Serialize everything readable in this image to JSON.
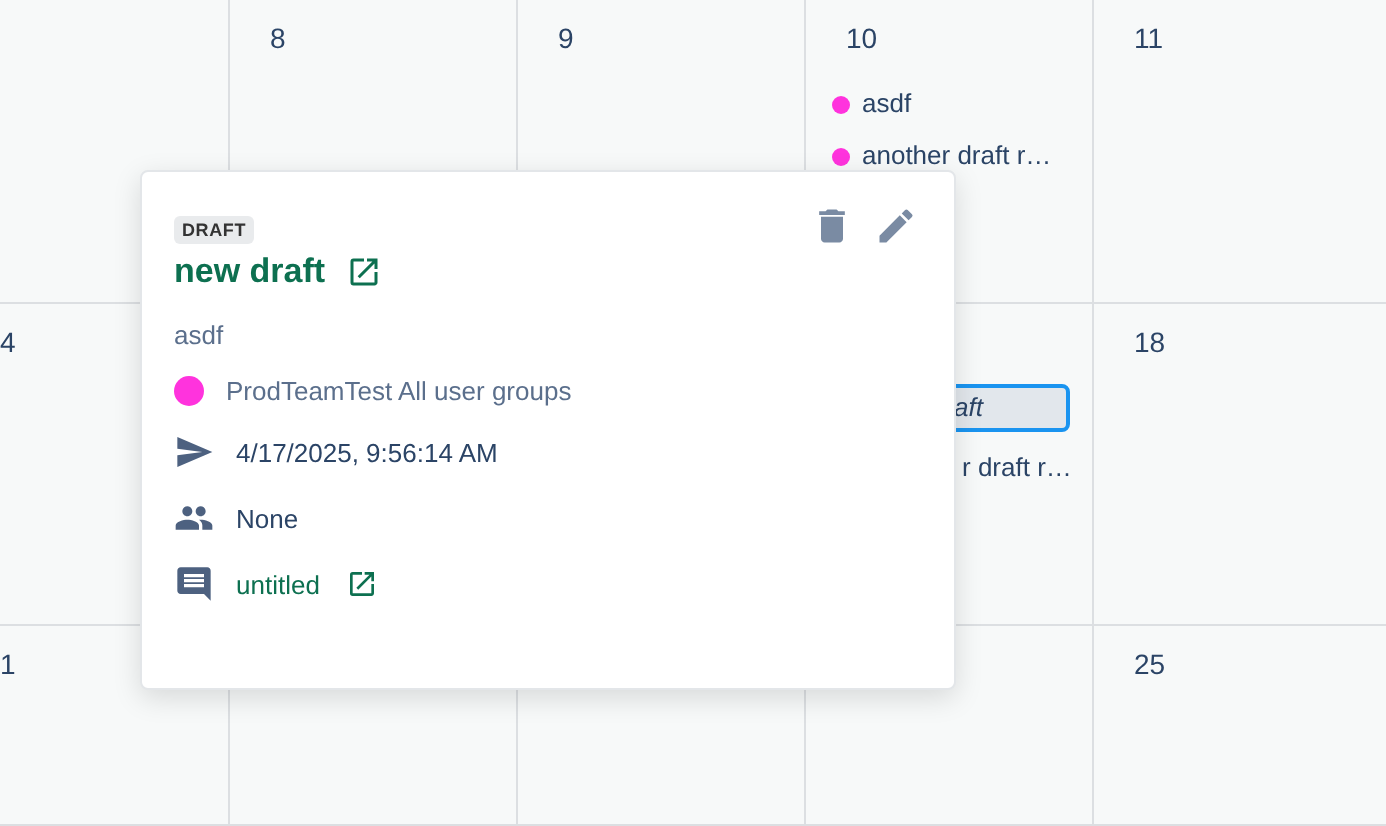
{
  "calendar": {
    "weeks": [
      {
        "days": [
          {
            "kind": "blank"
          },
          {
            "kind": "date",
            "day": "8"
          },
          {
            "kind": "date",
            "day": "9"
          },
          {
            "kind": "date",
            "day": "10",
            "events": [
              {
                "title": "asdf",
                "color": "#ff33dd",
                "selected": false
              },
              {
                "title": "another draft r…",
                "color": "#ff33dd",
                "selected": false
              }
            ]
          },
          {
            "kind": "date",
            "day": "11"
          }
        ]
      },
      {
        "days": [
          {
            "kind": "date",
            "day": "4"
          },
          {
            "kind": "blank"
          },
          {
            "kind": "blank"
          },
          {
            "kind": "blank",
            "events": [
              {
                "title": "aft",
                "selected": true
              },
              {
                "title": "r draft r…",
                "selected": false
              }
            ]
          },
          {
            "kind": "date",
            "day": "18"
          }
        ]
      },
      {
        "days": [
          {
            "kind": "date",
            "day": "1"
          },
          {
            "kind": "blank"
          },
          {
            "kind": "blank"
          },
          {
            "kind": "blank"
          },
          {
            "kind": "date",
            "day": "25"
          }
        ]
      }
    ]
  },
  "popover": {
    "badge": "DRAFT",
    "title": "new draft",
    "description": "asdf",
    "group": {
      "name": "ProdTeamTest All user groups",
      "color": "#ff33dd"
    },
    "details": [
      {
        "kind": "send",
        "text": "4/17/2025, 9:56:14 AM",
        "link": false
      },
      {
        "kind": "people",
        "text": "None",
        "link": false
      },
      {
        "kind": "comment",
        "text": "untitled",
        "link": true
      }
    ]
  }
}
